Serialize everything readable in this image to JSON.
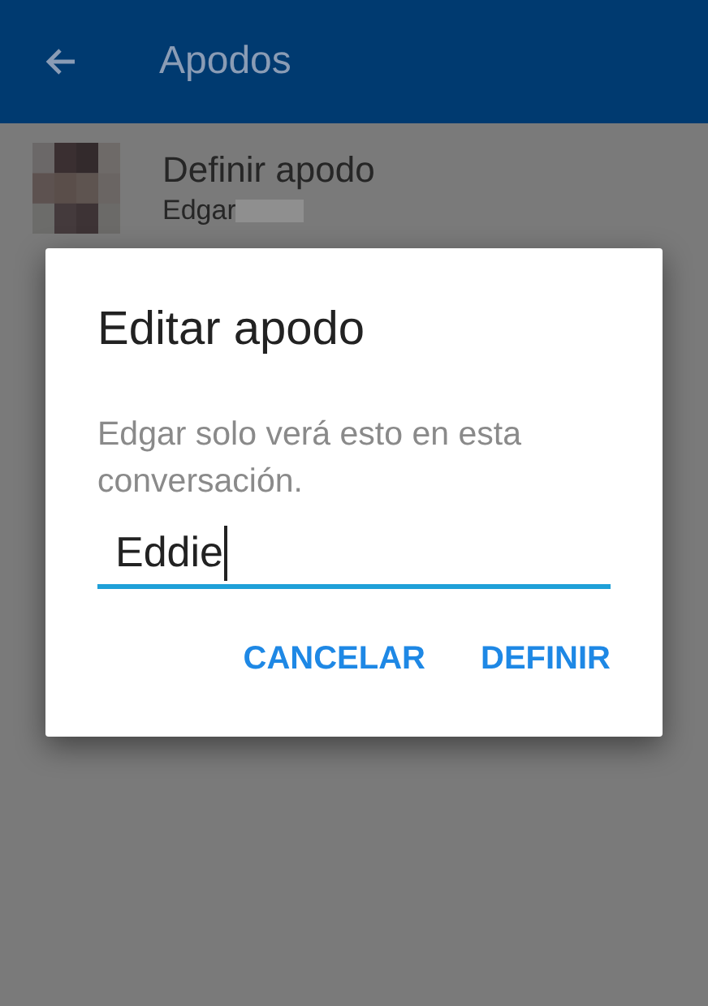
{
  "app_bar": {
    "title": "Apodos"
  },
  "contacts": [
    {
      "title": "Definir apodo",
      "subtitle": "Edgar"
    }
  ],
  "dialog": {
    "title": "Editar apodo",
    "message": "Edgar solo verá esto en esta conversación.",
    "field": {
      "value": "Eddie",
      "focused": true
    },
    "buttons": [
      {
        "label": "CANCELAR"
      },
      {
        "label": "DEFINIR"
      }
    ]
  }
}
